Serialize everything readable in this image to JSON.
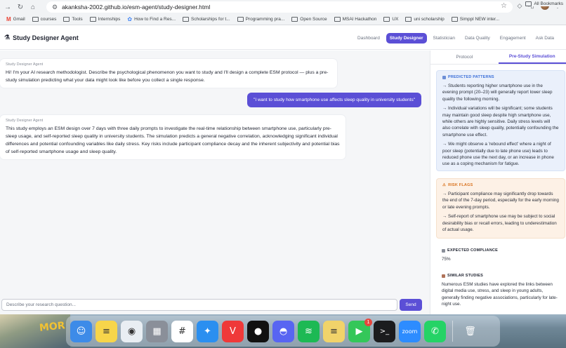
{
  "browser": {
    "url": "akanksha-2002.github.io/esm-agent/study-designer.html",
    "bookmarks": [
      {
        "label": "Gmail",
        "type": "gmail"
      },
      {
        "label": "courses",
        "type": "folder"
      },
      {
        "label": "Tools",
        "type": "folder"
      },
      {
        "label": "Internships",
        "type": "folder"
      },
      {
        "label": "How to Find a Res...",
        "type": "ai"
      },
      {
        "label": "Scholarships for t...",
        "type": "folder"
      },
      {
        "label": "Programming pra...",
        "type": "folder"
      },
      {
        "label": "Open Source",
        "type": "folder"
      },
      {
        "label": "MSAI Hackathon",
        "type": "folder"
      },
      {
        "label": "UX",
        "type": "folder"
      },
      {
        "label": "uni scholarship",
        "type": "folder"
      },
      {
        "label": "Simppl NEW inter...",
        "type": "folder"
      }
    ],
    "bookmarks_more": "»",
    "all_bookmarks": "All Bookmarks"
  },
  "app": {
    "title": "Study Designer Agent",
    "tabs": [
      {
        "label": "Dashboard",
        "active": false
      },
      {
        "label": "Study Designer",
        "active": true
      },
      {
        "label": "Statistician",
        "active": false
      },
      {
        "label": "Data Quality",
        "active": false
      },
      {
        "label": "Engagement",
        "active": false
      },
      {
        "label": "Ask Data",
        "active": false
      }
    ]
  },
  "chat": {
    "messages": [
      {
        "role": "assistant",
        "label": "Study Designer Agent",
        "text": "Hi! I'm your AI research methodologist. Describe the psychological phenomenon you want to study and I'll design a complete ESM protocol — plus a pre-study simulation predicting what your data might look like before you collect a single response."
      },
      {
        "role": "user",
        "text": "\"I want to study how smartphone use affects sleep quality in university students\""
      },
      {
        "role": "assistant",
        "label": "Study Designer Agent",
        "text": "This study employs an ESM design over 7 days with three daily prompts to investigate the real-time relationship between smartphone use, particularly pre-sleep usage, and self-reported sleep quality in university students. The simulation predicts a general negative correlation, acknowledging significant individual differences and potential confounding variables like daily stress. Key risks include participant compliance decay and the inherent subjectivity and potential bias of self-reported smartphone usage and sleep quality."
      }
    ],
    "input_placeholder": "Describe your research question...",
    "send_label": "Send"
  },
  "panel": {
    "tabs": [
      {
        "label": "Protocol",
        "active": false
      },
      {
        "label": "Pre-Study Simulation",
        "active": true
      }
    ],
    "predicted": {
      "icon": "chart-icon",
      "heading": "PREDICTED PATTERNS",
      "items": [
        "→ Students reporting higher smartphone use in the evening prompt (20–23) will generally report lower sleep quality the following morning.",
        "→ Individual variations will be significant; some students may maintain good sleep despite high smartphone use, while others are highly sensitive. Daily stress levels will also correlate with sleep quality, potentially confounding the smartphone use effect.",
        "→ We might observe a 'rebound effect' where a night of poor sleep (potentially due to late phone use) leads to reduced phone use the next day, or an increase in phone use as a coping mechanism for fatigue."
      ]
    },
    "risks": {
      "icon": "warning-icon",
      "heading": "RISK FLAGS",
      "items": [
        "→ Participant compliance may significantly drop towards the end of the 7-day period, especially for the early morning or late evening prompts.",
        "→ Self-report of smartphone use may be subject to social desirability bias or recall errors, leading to underestimation of actual usage."
      ]
    },
    "compliance": {
      "icon": "bar-chart-icon",
      "heading": "EXPECTED COMPLIANCE",
      "value": "75%"
    },
    "similar": {
      "icon": "book-icon",
      "heading": "SIMILAR STUDIES",
      "text": "Numerous ESM studies have explored the links between digital media use, stress, and sleep in young adults, generally finding negative associations, particularly for late-night use."
    }
  },
  "dock": {
    "desktop_text": "MOR",
    "apps": [
      {
        "name": "finder-icon",
        "glyph": "☺",
        "bg": "#3d8be8"
      },
      {
        "name": "notes-icon",
        "glyph": "≡",
        "bg": "#f7d54a"
      },
      {
        "name": "chrome-icon",
        "glyph": "◉",
        "bg": "#e9eef3"
      },
      {
        "name": "launchpad-icon",
        "glyph": "▦",
        "bg": "#8a8f99"
      },
      {
        "name": "slack-icon",
        "glyph": "#",
        "bg": "#ffffff"
      },
      {
        "name": "safari-icon",
        "glyph": "✦",
        "bg": "#2b8ff0"
      },
      {
        "name": "vivaldi-icon",
        "glyph": "V",
        "bg": "#ef3939"
      },
      {
        "name": "github-icon",
        "glyph": "●",
        "bg": "#111111"
      },
      {
        "name": "discord-icon",
        "glyph": "◓",
        "bg": "#5865f2"
      },
      {
        "name": "spotify-icon",
        "glyph": "≋",
        "bg": "#1db954"
      },
      {
        "name": "stickies-icon",
        "glyph": "≡",
        "bg": "#f1d36a"
      },
      {
        "name": "facetime-icon",
        "glyph": "▶",
        "bg": "#34c759",
        "badge": "1"
      },
      {
        "name": "terminal-icon",
        "glyph": ">_",
        "bg": "#1c1c1e"
      },
      {
        "name": "zoom-icon",
        "glyph": "zoom",
        "bg": "#2d8cff"
      },
      {
        "name": "whatsapp-icon",
        "glyph": "✆",
        "bg": "#25d366"
      },
      {
        "name": "trash-icon",
        "glyph": "🗑",
        "bg": "transparent"
      }
    ]
  }
}
